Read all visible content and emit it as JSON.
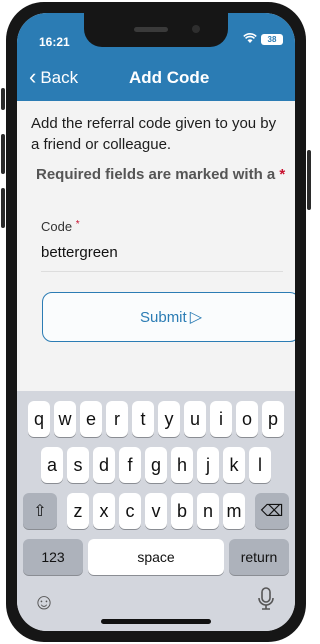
{
  "status_bar": {
    "time": "16:21",
    "battery": "38"
  },
  "nav": {
    "back_label": "Back",
    "title": "Add Code"
  },
  "form": {
    "intro_text": "Add the referral code given to you by a friend or colleague.",
    "required_text": "Required fields are marked with a",
    "required_marker": "*",
    "code_label": "Code",
    "code_value": "bettergreen",
    "submit_label": "Submit",
    "submit_icon": "▷"
  },
  "keyboard": {
    "row1": [
      "q",
      "w",
      "e",
      "r",
      "t",
      "y",
      "u",
      "i",
      "o",
      "p"
    ],
    "row2": [
      "a",
      "s",
      "d",
      "f",
      "g",
      "h",
      "j",
      "k",
      "l"
    ],
    "row3": [
      "z",
      "x",
      "c",
      "v",
      "b",
      "n",
      "m"
    ],
    "shift_icon": "⇧",
    "backspace_icon": "⌫",
    "numbers_label": "123",
    "space_label": "space",
    "return_label": "return",
    "emoji_icon": "☺"
  },
  "colors": {
    "accent": "#2b7cb4",
    "required": "#c8102e"
  }
}
